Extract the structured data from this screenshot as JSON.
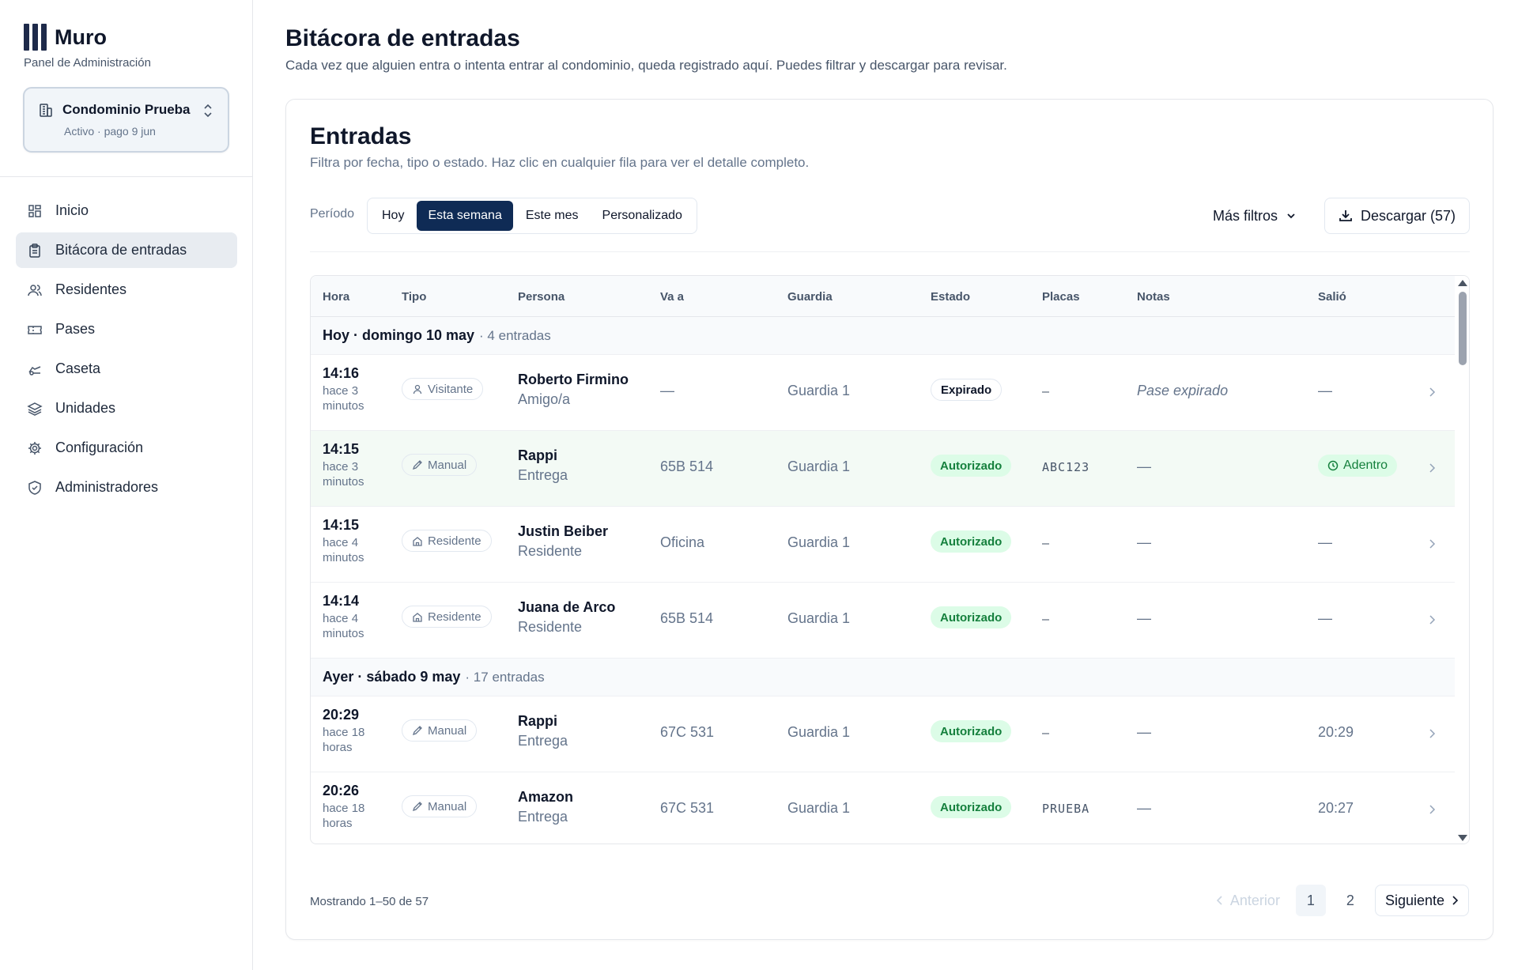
{
  "sidebar": {
    "brand_name": "Muro",
    "brand_sub": "Panel de Administración",
    "condo": {
      "name": "Condominio Prueba",
      "status": "Activo · pago 9 jun"
    },
    "nav": [
      {
        "label": "Inicio",
        "icon": "grid-icon"
      },
      {
        "label": "Bitácora de entradas",
        "icon": "clipboard-icon",
        "active": true
      },
      {
        "label": "Residentes",
        "icon": "users-icon"
      },
      {
        "label": "Pases",
        "icon": "ticket-icon"
      },
      {
        "label": "Caseta",
        "icon": "guardhouse-icon"
      },
      {
        "label": "Unidades",
        "icon": "layers-icon"
      },
      {
        "label": "Configuración",
        "icon": "gear-icon"
      },
      {
        "label": "Administradores",
        "icon": "shield-icon"
      }
    ]
  },
  "header": {
    "title": "Bitácora de entradas",
    "subtitle": "Cada vez que alguien entra o intenta entrar al condominio, queda registrado aquí. Puedes filtrar y descargar para revisar."
  },
  "card": {
    "title": "Entradas",
    "subtitle": "Filtra por fecha, tipo o estado. Haz clic en cualquier fila para ver el detalle completo.",
    "period_label": "Período",
    "periods": [
      "Hoy",
      "Esta semana",
      "Este mes",
      "Personalizado"
    ],
    "active_period": "Esta semana",
    "more_filters": "Más filtros",
    "download": "Descargar (57)"
  },
  "table": {
    "headers": [
      "Hora",
      "Tipo",
      "Persona",
      "Va a",
      "Guardia",
      "Estado",
      "Placas",
      "Notas",
      "Salió"
    ],
    "groups": [
      {
        "label": "Hoy · domingo 10 may",
        "count": "· 4 entradas",
        "rows": [
          {
            "time": "14:16",
            "rel": "hace 3 minutos",
            "tipo": "Visitante",
            "tipo_icon": "person-icon",
            "name": "Roberto Firmino",
            "role": "Amigo/a",
            "va_a": "—",
            "guardia": "Guardia 1",
            "estado": "Expirado",
            "placas": "–",
            "notas": "Pase expirado",
            "notas_italic": true,
            "salio": "—"
          },
          {
            "time": "14:15",
            "rel": "hace 3 minutos",
            "tipo": "Manual",
            "tipo_icon": "pencil-icon",
            "name": "Rappi",
            "role": "Entrega",
            "va_a": "65B 514",
            "guardia": "Guardia 1",
            "estado": "Autorizado",
            "placas": "ABC123",
            "notas": "—",
            "salio": "Adentro",
            "salio_pill": true,
            "highlight": true
          },
          {
            "time": "14:15",
            "rel": "hace 4 minutos",
            "tipo": "Residente",
            "tipo_icon": "home-icon",
            "name": "Justin Beiber",
            "role": "Residente",
            "va_a": "Oficina",
            "guardia": "Guardia 1",
            "estado": "Autorizado",
            "placas": "–",
            "notas": "—",
            "salio": "—"
          },
          {
            "time": "14:14",
            "rel": "hace 4 minutos",
            "tipo": "Residente",
            "tipo_icon": "home-icon",
            "name": "Juana de Arco",
            "role": "Residente",
            "va_a": "65B 514",
            "guardia": "Guardia 1",
            "estado": "Autorizado",
            "placas": "–",
            "notas": "—",
            "salio": "—"
          }
        ]
      },
      {
        "label": "Ayer · sábado 9 may",
        "count": "· 17 entradas",
        "rows": [
          {
            "time": "20:29",
            "rel": "hace 18 horas",
            "tipo": "Manual",
            "tipo_icon": "pencil-icon",
            "name": "Rappi",
            "role": "Entrega",
            "va_a": "67C 531",
            "guardia": "Guardia 1",
            "estado": "Autorizado",
            "placas": "–",
            "notas": "—",
            "salio": "20:29"
          },
          {
            "time": "20:26",
            "rel": "hace 18 horas",
            "tipo": "Manual",
            "tipo_icon": "pencil-icon",
            "name": "Amazon",
            "role": "Entrega",
            "va_a": "67C 531",
            "guardia": "Guardia 1",
            "estado": "Autorizado",
            "placas": "PRUEBA",
            "notas": "—",
            "salio": "20:27"
          }
        ]
      }
    ]
  },
  "footer": {
    "showing": "Mostrando 1–50 de 57",
    "prev": "Anterior",
    "pages": [
      "1",
      "2"
    ],
    "current_page": "1",
    "next": "Siguiente"
  },
  "colors": {
    "accent": "#0f2b55",
    "success_bg": "#dcfce7",
    "success_text": "#15803d"
  }
}
